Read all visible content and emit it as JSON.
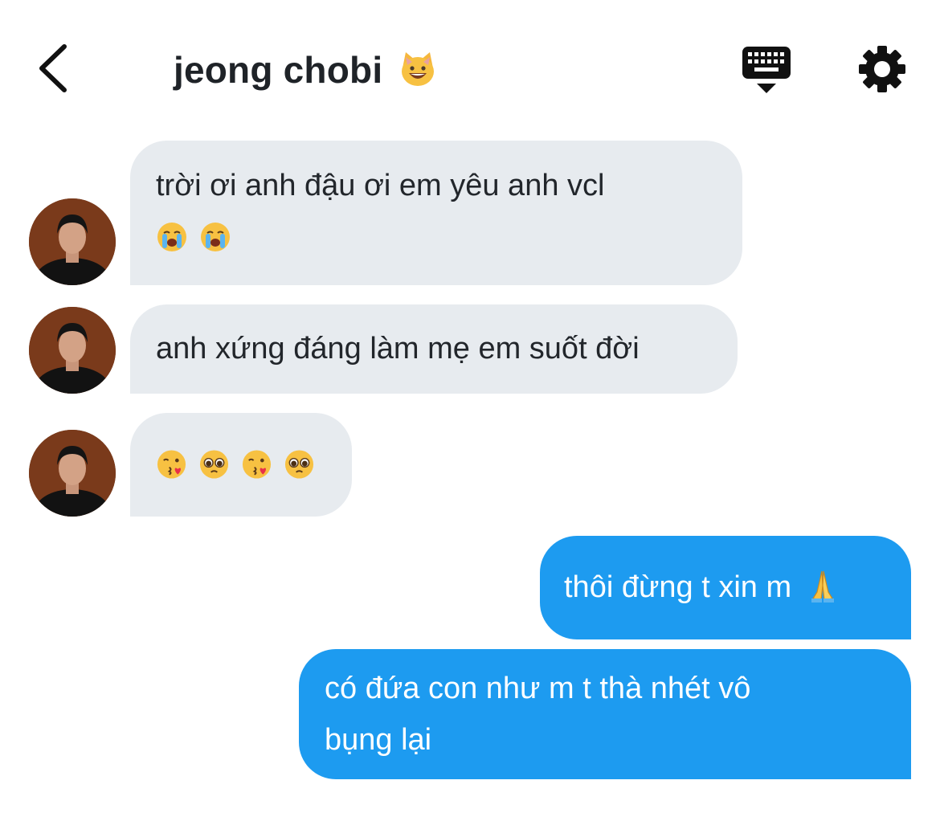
{
  "header": {
    "title": "jeong chobi",
    "title_emoji": "grinning-cat-emoji",
    "back_icon": "chevron-left-icon",
    "keyboard_icon": "keyboard-icon",
    "settings_icon": "gear-icon"
  },
  "messages": [
    {
      "direction": "incoming",
      "text": "trời ơi anh đậu ơi em yêu anh vcl",
      "emojis": [
        "loudly-crying-face-emoji",
        "loudly-crying-face-emoji"
      ]
    },
    {
      "direction": "incoming",
      "text": "anh xứng đáng làm mẹ em suốt đời"
    },
    {
      "direction": "incoming",
      "text": "",
      "emojis": [
        "face-blowing-kiss-emoji",
        "pleading-face-emoji",
        "face-blowing-kiss-emoji",
        "pleading-face-emoji"
      ]
    },
    {
      "direction": "outgoing",
      "text": "thôi đừng t xin m",
      "emojis": [
        "folded-hands-emoji"
      ]
    },
    {
      "direction": "outgoing",
      "lines": [
        "có đứa con như m t thà nhét vô",
        "bụng lại"
      ]
    }
  ],
  "colors": {
    "incoming_bubble": "#e7ebef",
    "outgoing_bubble": "#1d9bf0",
    "text_dark": "#1f2328"
  }
}
